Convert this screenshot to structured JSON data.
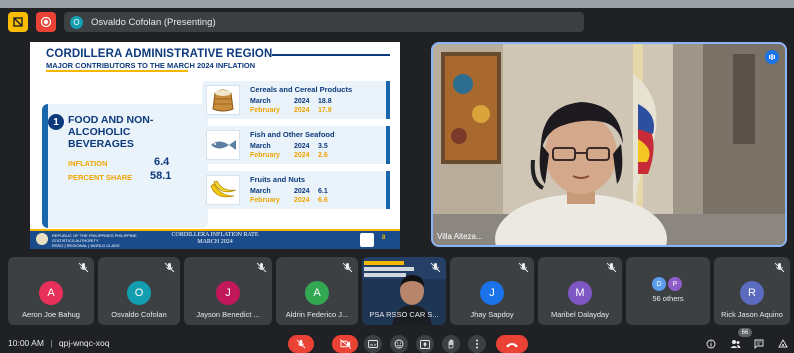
{
  "topbar": {
    "presenter_initial": "O",
    "presenter_label": "Osvaldo Cofolan (Presenting)"
  },
  "slide": {
    "title": "CORDILLERA ADMINISTRATIVE REGION",
    "subtitle": "MAJOR CONTRIBUTORS TO THE MARCH 2024 INFLATION",
    "category_number": "1",
    "category_title": "FOOD AND NON-ALCOHOLIC BEVERAGES",
    "inflation_label": "INFLATION",
    "inflation_value": "6.4",
    "share_label": "PERCENT SHARE",
    "share_value": "58.1",
    "cards": [
      {
        "title": "Cereals and Cereal Products",
        "rows": [
          {
            "month": "March",
            "year": "2024",
            "value": "18.8"
          },
          {
            "month": "February",
            "year": "2024",
            "value": "17.9"
          }
        ]
      },
      {
        "title": "Fish and Other Seafood",
        "rows": [
          {
            "month": "March",
            "year": "2024",
            "value": "3.5"
          },
          {
            "month": "February",
            "year": "2024",
            "value": "2.6"
          }
        ]
      },
      {
        "title": "Fruits and Nuts",
        "rows": [
          {
            "month": "March",
            "year": "2024",
            "value": "6.1"
          },
          {
            "month": "February",
            "year": "2024",
            "value": "6.6"
          }
        ]
      }
    ],
    "footer_left": "REPUBLIC OF THE PHILIPPINES PHILIPPINE STATISTICS AUTHORITY",
    "footer_left_sub": "RSSO | REGIONAL | WORLD CLASS",
    "footer_center_1": "CORDILLERA INFLATION RATE",
    "footer_center_2": "MARCH 2024",
    "page_number": "8"
  },
  "speaker": {
    "name": "Villa Alteza..."
  },
  "participants": [
    {
      "name": "Aeron Joe Bahug",
      "initial": "A",
      "color": "#e8305a"
    },
    {
      "name": "Osvaldo Cofolan",
      "initial": "O",
      "color": "#129eaf"
    },
    {
      "name": "Jayson Benedict ...",
      "initial": "J",
      "color": "#c2185b"
    },
    {
      "name": "Aldrin Federico J...",
      "initial": "A",
      "color": "#33a852"
    },
    {
      "name": "PSA RSSO CAR S...",
      "initial": "",
      "color": "#2d3a4a"
    },
    {
      "name": "Jhay Sapdoy",
      "initial": "J",
      "color": "#1a73e8"
    },
    {
      "name": "Maribel Dalayday",
      "initial": "M",
      "color": "#7e57c2"
    },
    {
      "name": "56 others",
      "initial": "",
      "color": "#3c4043"
    },
    {
      "name": "Rick Jason Aquino",
      "initial": "R",
      "color": "#5c6bc0"
    }
  ],
  "others_avatars": [
    {
      "initial": "D",
      "color": "#5c9ded"
    },
    {
      "initial": "P",
      "color": "#8e5bc8"
    }
  ],
  "bottom": {
    "time": "10:00 AM",
    "separator": "|",
    "meeting_code": "qpj-wnqc-xoq",
    "people_count": "66"
  },
  "colors": {
    "accent": "#8ab4f8",
    "end_call": "#ea4335",
    "slide_blue": "#0d3a7d",
    "slide_yellow": "#f5b800"
  }
}
